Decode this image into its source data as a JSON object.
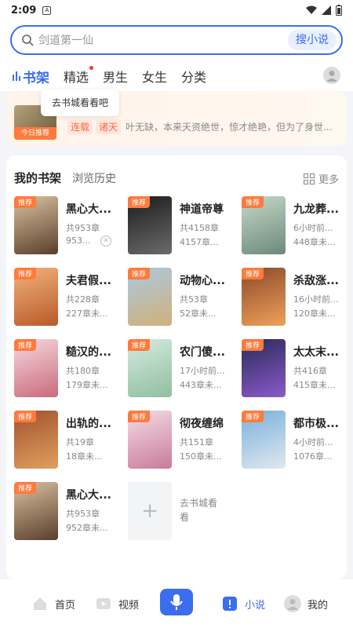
{
  "status_bar": {
    "time": "2:09"
  },
  "search": {
    "placeholder": "剑道第一仙",
    "button": "搜小说"
  },
  "tabs": [
    {
      "label": "书架",
      "active": true
    },
    {
      "label": "精选",
      "dot": true
    },
    {
      "label": "男生"
    },
    {
      "label": "女生"
    },
    {
      "label": "分类"
    }
  ],
  "banner": {
    "tooltip": "去书城看看吧",
    "today_label": "今日推荐",
    "tags": [
      "连载",
      "诸天"
    ],
    "description": "叶无缺，本来天资绝世，惊才绝艳，但为了身世..."
  },
  "shelf": {
    "tab_active": "我的书架",
    "tab_other": "浏览历史",
    "more": "更多",
    "badge": "推荐",
    "books": [
      {
        "title": "黑心大...",
        "line1": "共953章",
        "line2": "953...",
        "colors": [
          "#d9c2a0",
          "#5a3e2b"
        ]
      },
      {
        "title": "神道帝尊",
        "line1": "共4158章",
        "line2": "4157章...",
        "colors": [
          "#1c1c1c",
          "#6b6b6b"
        ]
      },
      {
        "title": "九龙葬...",
        "line1": "6小时前...",
        "line2": "448章未...",
        "colors": [
          "#c7d8c8",
          "#6a8a7a"
        ]
      },
      {
        "title": "夫君假...",
        "line1": "共228章",
        "line2": "227章未...",
        "colors": [
          "#f2b37a",
          "#b85a2a"
        ]
      },
      {
        "title": "动物心...",
        "line1": "共53章",
        "line2": "52章未...",
        "colors": [
          "#a9c9e0",
          "#d1b07a"
        ]
      },
      {
        "title": "杀敌涨...",
        "line1": "16小时前...",
        "line2": "120章未...",
        "colors": [
          "#8a4a2a",
          "#f0a05a"
        ]
      },
      {
        "title": "糙汉的...",
        "line1": "共180章",
        "line2": "179章未...",
        "colors": [
          "#f6d9df",
          "#c96a7a"
        ]
      },
      {
        "title": "农门傻...",
        "line1": "17小时前...",
        "line2": "443章未...",
        "colors": [
          "#d6eadf",
          "#8fbf9f"
        ]
      },
      {
        "title": "太太末...",
        "line1": "共416章",
        "line2": "415章未...",
        "colors": [
          "#2a2a5a",
          "#8a5ac9"
        ]
      },
      {
        "title": "出轨的...",
        "line1": "共19章",
        "line2": "18章未...",
        "colors": [
          "#a0522d",
          "#e0a060"
        ]
      },
      {
        "title": "彻夜缠绵",
        "line1": "共151章",
        "line2": "150章未...",
        "colors": [
          "#f4dde6",
          "#c97a9a"
        ]
      },
      {
        "title": "都市极...",
        "line1": "4小时前...",
        "line2": "1076章...",
        "colors": [
          "#7ab0d9",
          "#e0e8f0"
        ]
      },
      {
        "title": "黑心大...",
        "line1": "共953章",
        "line2": "952章未...",
        "colors": [
          "#d9c2a0",
          "#5a3e2b"
        ]
      }
    ],
    "add_label": "去书城看看"
  },
  "bottom_nav": [
    {
      "label": "首页",
      "icon": "home-icon"
    },
    {
      "label": "视频",
      "icon": "video-icon"
    },
    {
      "label": "小说",
      "icon": "novel-icon",
      "active": true
    },
    {
      "label": "我的",
      "icon": "profile-icon"
    }
  ],
  "colors": {
    "accent": "#3b6df0",
    "badge": "#ff7a3b"
  }
}
